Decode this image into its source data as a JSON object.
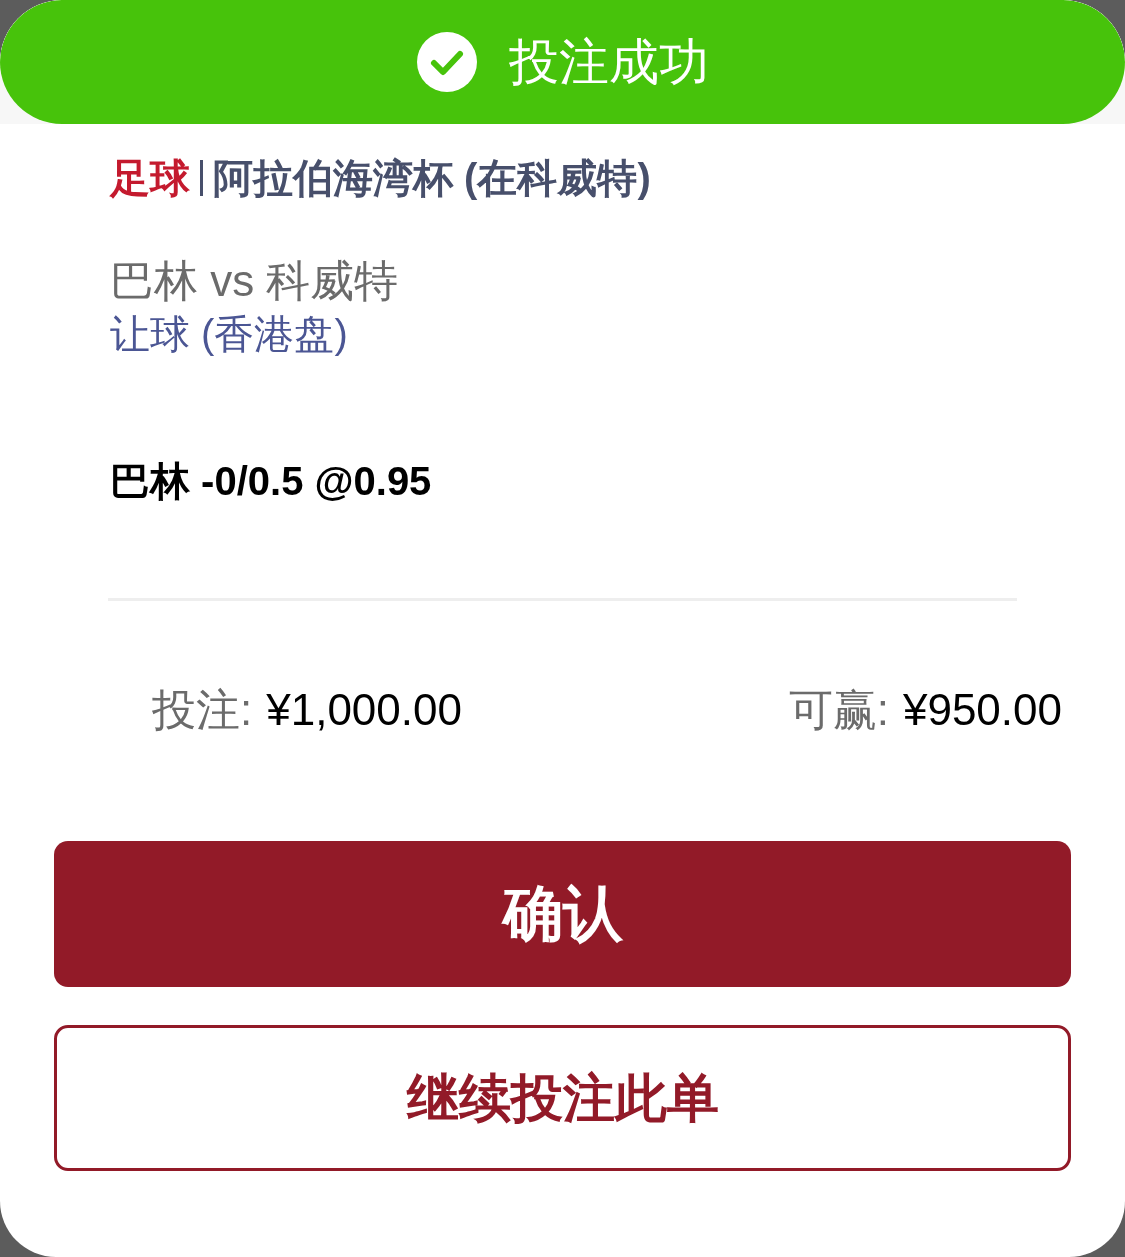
{
  "banner": {
    "title": "投注成功"
  },
  "bet": {
    "sport": "足球",
    "league": "阿拉伯海湾杯 (在科威特)",
    "match": "巴林 vs 科威特",
    "market": "让球 (香港盘)",
    "selection": "巴林 -0/0.5 @0.95"
  },
  "summary": [
    {
      "label": "投注:",
      "value": "¥1,000.00"
    },
    {
      "label": "可赢:",
      "value": "¥950.00"
    }
  ],
  "buttons": [
    {
      "label": "确认",
      "kind": "primary"
    },
    {
      "label": "继续投注此单",
      "kind": "outline"
    }
  ]
}
